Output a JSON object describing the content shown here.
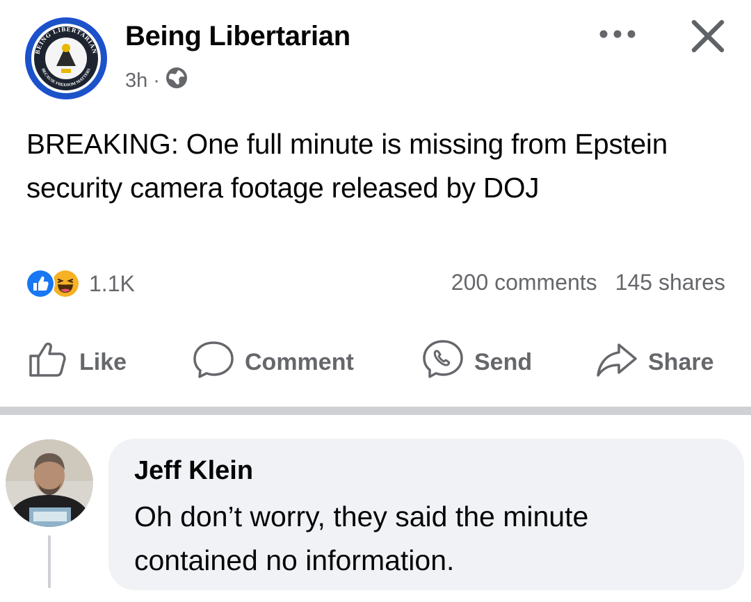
{
  "post": {
    "page_name": "Being Libertarian",
    "time": "3h",
    "separator": "·",
    "text": "BREAKING: One full minute is missing from Epstein security camera footage released by DOJ",
    "reaction_count": "1.1K",
    "comments": "200 comments",
    "shares": "145 shares",
    "logo_text_top": "BEING LIBERTARIAN",
    "logo_text_bottom": "BECAUSE FREEDOM MATTERS"
  },
  "actions": {
    "like": "Like",
    "comment": "Comment",
    "send": "Send",
    "share": "Share"
  },
  "comment": {
    "author": "Jeff Klein",
    "text": "Oh don’t worry, they said the minute contained no information."
  },
  "colors": {
    "brand_blue": "#1877f2",
    "secondary_text": "#65676b",
    "bubble_bg": "#f0f2f5",
    "divider": "#ced0d4"
  },
  "icons": [
    "globe-icon",
    "more-icon",
    "close-icon",
    "like-reaction-icon",
    "haha-reaction-icon",
    "thumbs-up-icon",
    "comment-icon",
    "messenger-icon",
    "share-icon"
  ]
}
